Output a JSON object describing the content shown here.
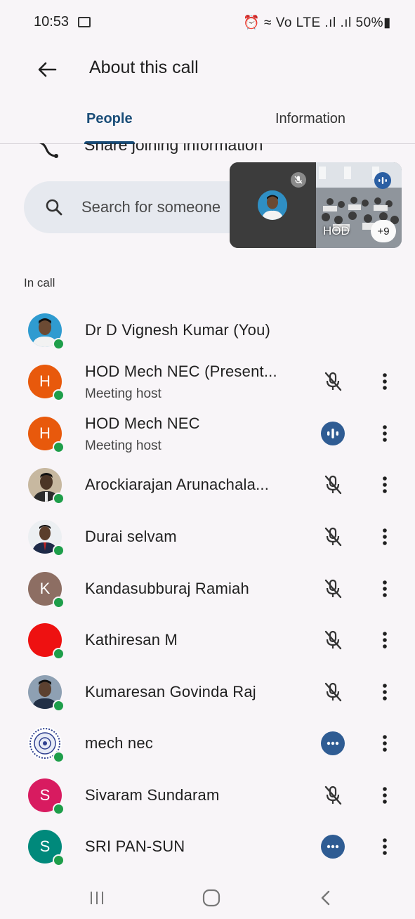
{
  "status_bar": {
    "time": "10:53",
    "right_text": "⏰ ≈ Vo LTE .ıl .ıl 50%▮"
  },
  "app_bar": {
    "title": "About this call"
  },
  "tabs": [
    {
      "label": "People",
      "active": true
    },
    {
      "label": "Information",
      "active": false
    }
  ],
  "share": {
    "label": "Share joining information"
  },
  "search": {
    "placeholder": "Search for someone"
  },
  "pip": {
    "room_label": "HOD",
    "more_count": "+9"
  },
  "section": {
    "label": "In call"
  },
  "participants": [
    {
      "name": "Dr D Vignesh Kumar (You)",
      "subtitle": "",
      "avatar_letter": "",
      "avatar_type": "photo-self",
      "status": "none"
    },
    {
      "name": "HOD Mech NEC (Present...",
      "subtitle": "Meeting host",
      "avatar_letter": "H",
      "avatar_type": "letter",
      "avatar_color": "#e8590c",
      "status": "muted"
    },
    {
      "name": "HOD Mech NEC",
      "subtitle": "Meeting host",
      "avatar_letter": "H",
      "avatar_type": "letter",
      "avatar_color": "#e8590c",
      "status": "speaking"
    },
    {
      "name": "Arockiarajan Arunachala...",
      "subtitle": "",
      "avatar_letter": "",
      "avatar_type": "photo",
      "status": "muted"
    },
    {
      "name": "Durai selvam",
      "subtitle": "",
      "avatar_letter": "",
      "avatar_type": "photo",
      "status": "muted"
    },
    {
      "name": "Kandasubburaj Ramiah",
      "subtitle": "",
      "avatar_letter": "K",
      "avatar_type": "letter",
      "avatar_color": "#8d6e63",
      "status": "muted"
    },
    {
      "name": "Kathiresan M",
      "subtitle": "",
      "avatar_letter": "",
      "avatar_type": "solid",
      "avatar_color": "#ee1111",
      "status": "muted"
    },
    {
      "name": "Kumaresan Govinda Raj",
      "subtitle": "",
      "avatar_letter": "",
      "avatar_type": "photo",
      "status": "muted"
    },
    {
      "name": "mech nec",
      "subtitle": "",
      "avatar_letter": "",
      "avatar_type": "emblem",
      "status": "more"
    },
    {
      "name": "Sivaram Sundaram",
      "subtitle": "",
      "avatar_letter": "S",
      "avatar_type": "letter",
      "avatar_color": "#d81b60",
      "status": "muted"
    },
    {
      "name": "SRI PAN-SUN",
      "subtitle": "",
      "avatar_letter": "S",
      "avatar_type": "letter",
      "avatar_color": "#00897b",
      "status": "more"
    }
  ],
  "colors": {
    "accent": "#1a4d78",
    "presence": "#1e9e4a",
    "status_bubble": "#2f5c93",
    "background": "#f8f5f8"
  },
  "icons": {
    "back": "arrow-left-icon",
    "search": "search-icon",
    "share": "share-icon",
    "muted": "mic-off-icon",
    "speaking": "audio-level-icon",
    "more_status": "ellipsis-icon",
    "menu": "more-vert-icon"
  }
}
